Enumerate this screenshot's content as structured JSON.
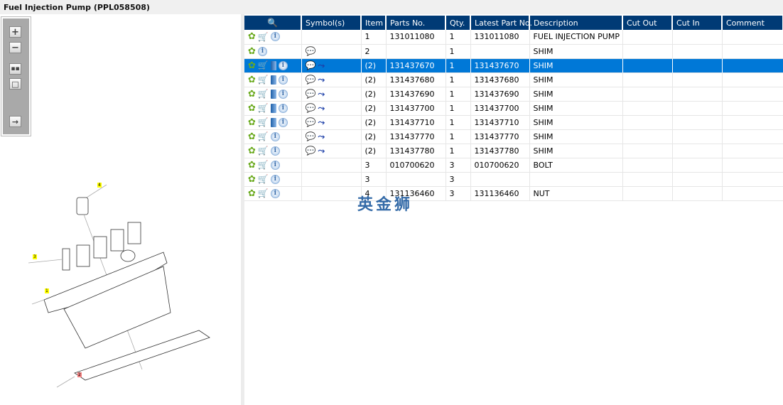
{
  "title": "Fuel Injection Pump (PPL058508)",
  "toolbar": [
    "zoom-in",
    "zoom-out",
    "fit-all",
    "fit-window",
    "toggle-panel"
  ],
  "callouts": {
    "c1": "1",
    "c2": "2",
    "c3": "3",
    "c4": "4"
  },
  "columns": [
    "",
    "Symbol(s)",
    "Item",
    "Parts No.",
    "Qty.",
    "Latest Part No.",
    "Description",
    "Cut Out",
    "Cut In",
    "Comment"
  ],
  "rows": [
    {
      "icons": [
        "gear",
        "cart",
        "info"
      ],
      "symbols": [],
      "item": "1",
      "part": "131011080",
      "qty": "1",
      "latest": "131011080",
      "desc": "FUEL INJECTION PUMP"
    },
    {
      "icons": [
        "gear",
        "info"
      ],
      "symbols": [
        "note"
      ],
      "item": "2",
      "part": "",
      "qty": "1",
      "latest": "",
      "desc": "SHIM"
    },
    {
      "icons": [
        "gear",
        "cart",
        "book",
        "info"
      ],
      "symbols": [
        "note",
        "replace"
      ],
      "item": "(2)",
      "part": "131437670",
      "qty": "1",
      "latest": "131437670",
      "desc": "SHIM",
      "selected": true
    },
    {
      "icons": [
        "gear",
        "cart",
        "book",
        "info"
      ],
      "symbols": [
        "note",
        "replace"
      ],
      "item": "(2)",
      "part": "131437680",
      "qty": "1",
      "latest": "131437680",
      "desc": "SHIM"
    },
    {
      "icons": [
        "gear",
        "cart",
        "book",
        "info"
      ],
      "symbols": [
        "note",
        "replace"
      ],
      "item": "(2)",
      "part": "131437690",
      "qty": "1",
      "latest": "131437690",
      "desc": "SHIM"
    },
    {
      "icons": [
        "gear",
        "cart",
        "book",
        "info"
      ],
      "symbols": [
        "note",
        "replace"
      ],
      "item": "(2)",
      "part": "131437700",
      "qty": "1",
      "latest": "131437700",
      "desc": "SHIM"
    },
    {
      "icons": [
        "gear",
        "cart",
        "book",
        "info"
      ],
      "symbols": [
        "note",
        "replace"
      ],
      "item": "(2)",
      "part": "131437710",
      "qty": "1",
      "latest": "131437710",
      "desc": "SHIM"
    },
    {
      "icons": [
        "gear",
        "cart",
        "info"
      ],
      "symbols": [
        "note",
        "replace"
      ],
      "item": "(2)",
      "part": "131437770",
      "qty": "1",
      "latest": "131437770",
      "desc": "SHIM"
    },
    {
      "icons": [
        "gear",
        "cart",
        "info"
      ],
      "symbols": [
        "note",
        "replace"
      ],
      "item": "(2)",
      "part": "131437780",
      "qty": "1",
      "latest": "131437780",
      "desc": "SHIM"
    },
    {
      "icons": [
        "gear",
        "cart",
        "info"
      ],
      "symbols": [],
      "item": "3",
      "part": "010700620",
      "qty": "3",
      "latest": "010700620",
      "desc": "BOLT"
    },
    {
      "icons": [
        "gear",
        "cart",
        "info"
      ],
      "symbols": [],
      "item": "3",
      "part": "",
      "qty": "3",
      "latest": "",
      "desc": ""
    },
    {
      "icons": [
        "gear",
        "cart",
        "info"
      ],
      "symbols": [],
      "item": "4",
      "part": "131136460",
      "qty": "3",
      "latest": "131136460",
      "desc": "NUT"
    }
  ],
  "watermark": "英金狮",
  "colors": {
    "header": "#003a75",
    "selected": "#0078d7"
  }
}
